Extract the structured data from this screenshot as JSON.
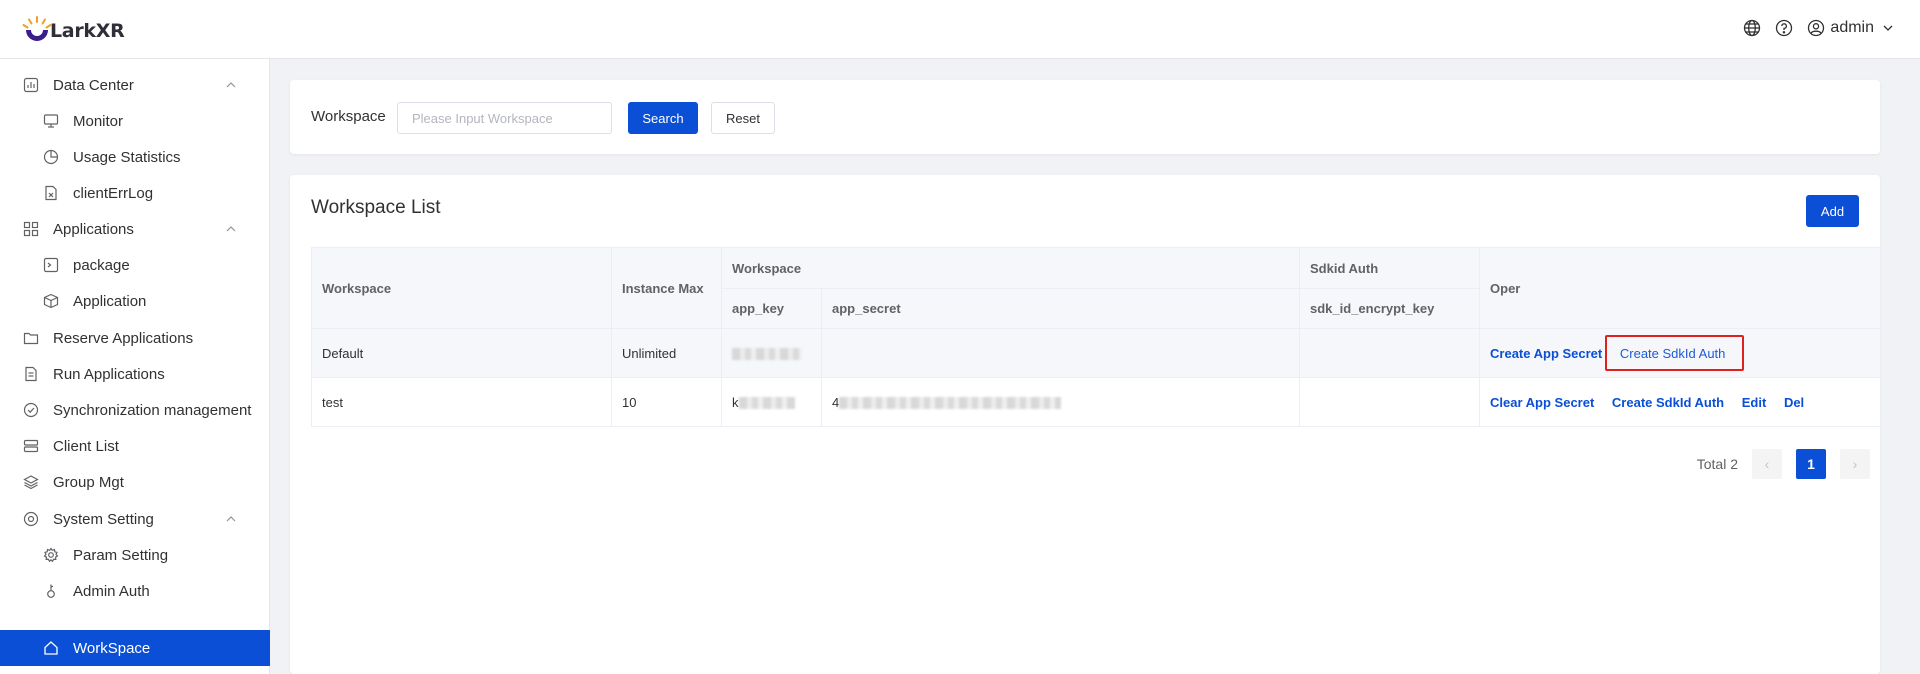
{
  "app": {
    "name": "LarkXR"
  },
  "header": {
    "user": "admin"
  },
  "sidebar": {
    "items": [
      {
        "label": "Data Center"
      },
      {
        "label": "Monitor"
      },
      {
        "label": "Usage Statistics"
      },
      {
        "label": "clientErrLog"
      },
      {
        "label": "Applications"
      },
      {
        "label": "package"
      },
      {
        "label": "Application"
      },
      {
        "label": "Reserve Applications"
      },
      {
        "label": "Run Applications"
      },
      {
        "label": "Synchronization management"
      },
      {
        "label": "Client List"
      },
      {
        "label": "Group Mgt"
      },
      {
        "label": "System Setting"
      },
      {
        "label": "Param Setting"
      },
      {
        "label": "Admin Auth"
      },
      {
        "label": "WorkSpace"
      }
    ]
  },
  "search": {
    "label": "Workspace",
    "placeholder": "Please Input Workspace",
    "search_button": "Search",
    "reset_button": "Reset"
  },
  "list": {
    "title": "Workspace List",
    "add_button": "Add",
    "headers": {
      "workspace": "Workspace",
      "instance_max": "Instance Max",
      "workspace_group": "Workspace",
      "app_key": "app_key",
      "app_secret": "app_secret",
      "sdkid_group": "Sdkid Auth",
      "sdk_key": "sdk_id_encrypt_key",
      "oper": "Oper"
    },
    "rows": [
      {
        "workspace": "Default",
        "instance_max": "Unlimited",
        "app_key_visible": "",
        "app_secret_visible": "",
        "sdk_key": "",
        "ops": [
          "Create App Secret",
          "Create SdkId Auth"
        ]
      },
      {
        "workspace": "test",
        "instance_max": "10",
        "app_key_visible": "k",
        "app_secret_visible": "4",
        "sdk_key": "",
        "ops": [
          "Clear App Secret",
          "Create SdkId Auth",
          "Edit",
          "Del"
        ]
      }
    ]
  },
  "pagination": {
    "total_label": "Total 2",
    "current_page": "1"
  },
  "colors": {
    "primary": "#0a4fd6",
    "highlight_outline": "#e0201c"
  }
}
